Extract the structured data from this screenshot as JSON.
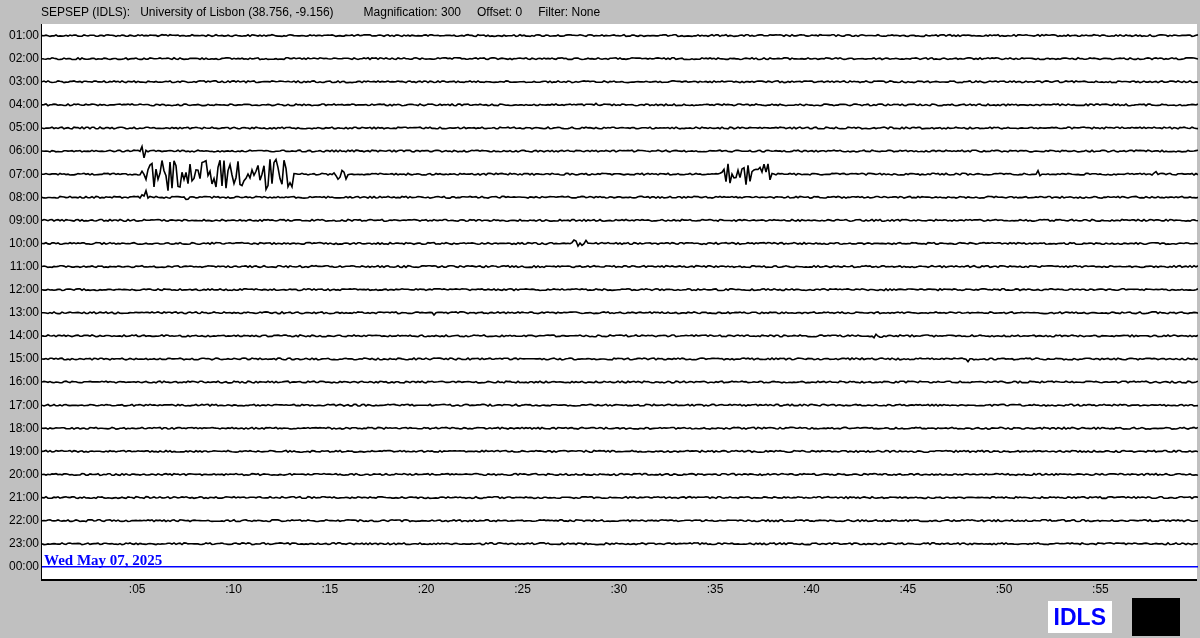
{
  "header": {
    "station": "SEPSEP (IDLS):",
    "location": "University of Lisbon (38.756, -9.156)",
    "magnification": "Magnification: 300",
    "offset": "Offset: 0",
    "filter": "Filter: None"
  },
  "helicorder": {
    "rows": [
      {
        "label": "01:00",
        "kind": "trace"
      },
      {
        "label": "02:00",
        "kind": "trace"
      },
      {
        "label": "03:00",
        "kind": "trace"
      },
      {
        "label": "04:00",
        "kind": "trace"
      },
      {
        "label": "05:00",
        "kind": "trace"
      },
      {
        "label": "06:00",
        "kind": "trace"
      },
      {
        "label": "07:00",
        "kind": "trace"
      },
      {
        "label": "08:00",
        "kind": "trace"
      },
      {
        "label": "09:00",
        "kind": "trace"
      },
      {
        "label": "10:00",
        "kind": "trace"
      },
      {
        "label": "11:00",
        "kind": "trace"
      },
      {
        "label": "12:00",
        "kind": "trace"
      },
      {
        "label": "13:00",
        "kind": "trace"
      },
      {
        "label": "14:00",
        "kind": "trace"
      },
      {
        "label": "15:00",
        "kind": "trace"
      },
      {
        "label": "16:00",
        "kind": "trace"
      },
      {
        "label": "17:00",
        "kind": "trace"
      },
      {
        "label": "18:00",
        "kind": "trace"
      },
      {
        "label": "19:00",
        "kind": "trace"
      },
      {
        "label": "20:00",
        "kind": "trace"
      },
      {
        "label": "21:00",
        "kind": "trace"
      },
      {
        "label": "22:00",
        "kind": "trace"
      },
      {
        "label": "23:00",
        "kind": "trace"
      },
      {
        "label": "00:00",
        "kind": "current"
      }
    ],
    "date": "Wed May 07, 2025",
    "x_ticks": [
      ":05",
      ":10",
      ":15",
      ":20",
      ":25",
      ":30",
      ":35",
      ":40",
      ":45",
      ":50",
      ":55"
    ]
  },
  "logo": {
    "text": "IDLS"
  }
}
